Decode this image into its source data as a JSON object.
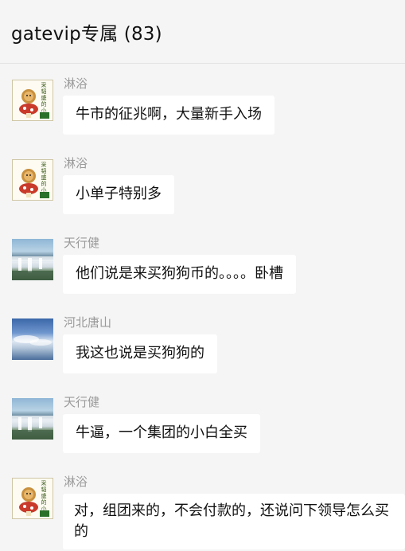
{
  "header": {
    "title": "gatevip专属 (83)"
  },
  "messages": [
    {
      "sender": "淋浴",
      "text": "牛市的征兆啊，大量新手入场",
      "avatar": "sticker-avatar"
    },
    {
      "sender": "淋浴",
      "text": "小单子特别多",
      "avatar": "sticker-avatar"
    },
    {
      "sender": "天行健",
      "text": "他们说是来买狗狗币的。。。。卧槽",
      "avatar": "waterfall-avatar"
    },
    {
      "sender": "河北唐山",
      "text": "我这也说是买狗狗的",
      "avatar": "sky-avatar"
    },
    {
      "sender": "天行健",
      "text": "牛逼，一个集团的小白全买",
      "avatar": "waterfall-avatar"
    },
    {
      "sender": "淋浴",
      "text": "对，组团来的，不会付款的，还说问下领导怎么买的",
      "avatar": "sticker-avatar"
    }
  ],
  "sticker_text": [
    "采",
    "韬",
    "盛",
    "的",
    "小",
    "蘑",
    "菇"
  ]
}
